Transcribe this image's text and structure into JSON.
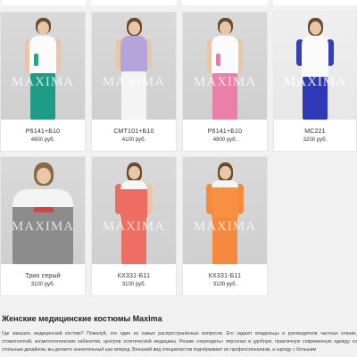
{
  "products": [
    {
      "name": "Р6141+Б10",
      "price": "4900 руб."
    },
    {
      "name": "СМТ101+Б10",
      "price": "4100 руб."
    },
    {
      "name": "Р6141+Б10",
      "price": "4900 руб."
    },
    {
      "name": "МС221",
      "price": "3200 руб."
    },
    {
      "name": "Трио серый",
      "price": "3100 руб."
    },
    {
      "name": "КХ331-Б11",
      "price": "3100 руб."
    },
    {
      "name": "КХ331-Б11",
      "price": "3100 руб."
    }
  ],
  "watermark": "MAXIMA",
  "section": {
    "title": "Женские медицинские костюмы Maxima",
    "text": "Где заказать медицинский костюм? Пожалуй, это один из самых распространённых вопросов. Его задают владельцы и руководители частных клиник, стоматологий, косметологических кабинетов, центров эстетической медицины. Решив «переодеть» персонал в удобную, практичную современную одежду со стильным дизайном, вы делаете значительный шаг вперед. Внешний вид специалистов подчёркивает их профессионализм, а наряду с большим"
  },
  "colors": {
    "page_bg": "#f1f1f1",
    "card_bg": "#ffffff"
  }
}
